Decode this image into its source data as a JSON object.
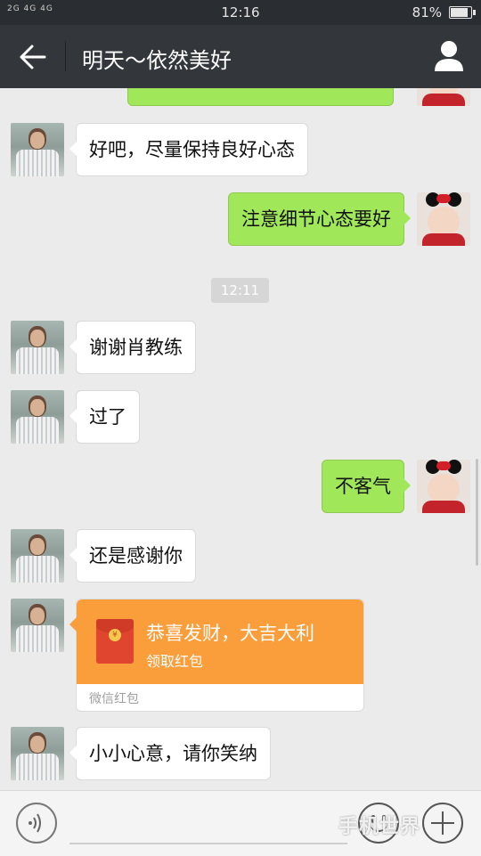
{
  "status_bar": {
    "signal_text": "2G 4G 4G",
    "time": "12:16",
    "battery_percent": "81%",
    "battery_level": 0.81
  },
  "header": {
    "title": "明天～依然美好"
  },
  "messages": [
    {
      "side": "left",
      "text": "好吧，尽量保持良好心态"
    },
    {
      "side": "right",
      "text": "注意细节心态要好"
    },
    {
      "side": "left",
      "text": "谢谢肖教练"
    },
    {
      "side": "left",
      "text": "过了"
    },
    {
      "side": "right",
      "text": "不客气"
    },
    {
      "side": "left",
      "text": "还是感谢你"
    },
    {
      "side": "left",
      "text": "小小心意，请你笑纳"
    }
  ],
  "timestamp": "12:11",
  "red_packet": {
    "title": "恭喜发财，大吉大利",
    "subtitle": "领取红包",
    "footer": "微信红包",
    "coin_symbol": "¥"
  },
  "watermark": "手机世界",
  "colors": {
    "header_bg": "#33373b",
    "bubble_green": "#a1e75a",
    "red_packet": "#fa9d3b"
  }
}
